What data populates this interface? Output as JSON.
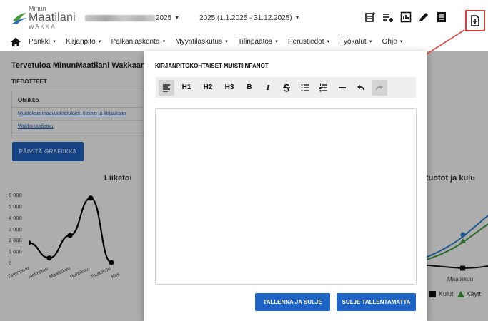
{
  "header": {
    "logo": {
      "line1": "Minun",
      "line2": "Maatilani",
      "line3": "WAKKA"
    },
    "company": {
      "suffix": "2025"
    },
    "period": {
      "label": "2025 (1.1.2025 - 31.12.2025)"
    },
    "icons": [
      "notes-list-icon",
      "playlist-add-icon",
      "report-chart-icon",
      "pencil-icon",
      "document-icon",
      "note-add-icon"
    ]
  },
  "nav": {
    "items": [
      {
        "label": "Pankki"
      },
      {
        "label": "Kirjanpito"
      },
      {
        "label": "Palkanlaskenta"
      },
      {
        "label": "Myyntilaskutus"
      },
      {
        "label": "Tilinpäätös"
      },
      {
        "label": "Perustiedot"
      },
      {
        "label": "Työkalut"
      },
      {
        "label": "Ohje"
      }
    ]
  },
  "background": {
    "welcome": "Tervetuloa MinunMaatilani Wakkaan K",
    "news_heading": "TIEDOTTEET",
    "news_column": "Otsikko",
    "news_items": [
      "Muutoksia maavuokratulojen tileihin ja kirjauksiin",
      "Wakka uudistuu"
    ],
    "refresh_button": "PÄIVITÄ GRAFIIKKA",
    "chart1_title": "Liiketoi",
    "chart2_title": "te, tuotot ja kulu",
    "chart2_category": "Maaliskuu",
    "legend2": {
      "kulut": "Kulut",
      "kaytt": "Käytt"
    }
  },
  "chart_data": [
    {
      "type": "line",
      "title": "Liiketoi",
      "categories": [
        "Tammikuu",
        "Helmikuu",
        "Maaliskuu",
        "Huhtikuu",
        "Toukokuu",
        "Kes"
      ],
      "values": [
        1750,
        400,
        2400,
        5700,
        0,
        null
      ],
      "yticks": [
        "6 000",
        "5 000",
        "4 000",
        "3 000",
        "2 000",
        "1 000",
        "0"
      ],
      "ylim": [
        0,
        6000
      ],
      "color": "#000000"
    },
    {
      "type": "line",
      "title": "te, tuotot ja kulu",
      "categories": [
        "Maaliskuu"
      ],
      "series": [
        {
          "name": "Kulut",
          "color": "#000000"
        },
        {
          "name": "Käytt",
          "color": "#3c9a3c"
        },
        {
          "color": "#2f7fd0"
        }
      ]
    }
  ],
  "modal": {
    "title": "KIRJANPITOKOHTAISET MUISTIINPANOT",
    "toolbar": {
      "h1": "H1",
      "h2": "H2",
      "h3": "H3",
      "bold": "B",
      "italic": "I"
    },
    "editor_content": "",
    "save_button": "TALLENNA JA SULJE",
    "close_button": "SULJE TALLENTAMATTA"
  },
  "colors": {
    "primary": "#1f63c6",
    "highlight": "#e53935",
    "toolbar_bg": "#eeeeee"
  }
}
